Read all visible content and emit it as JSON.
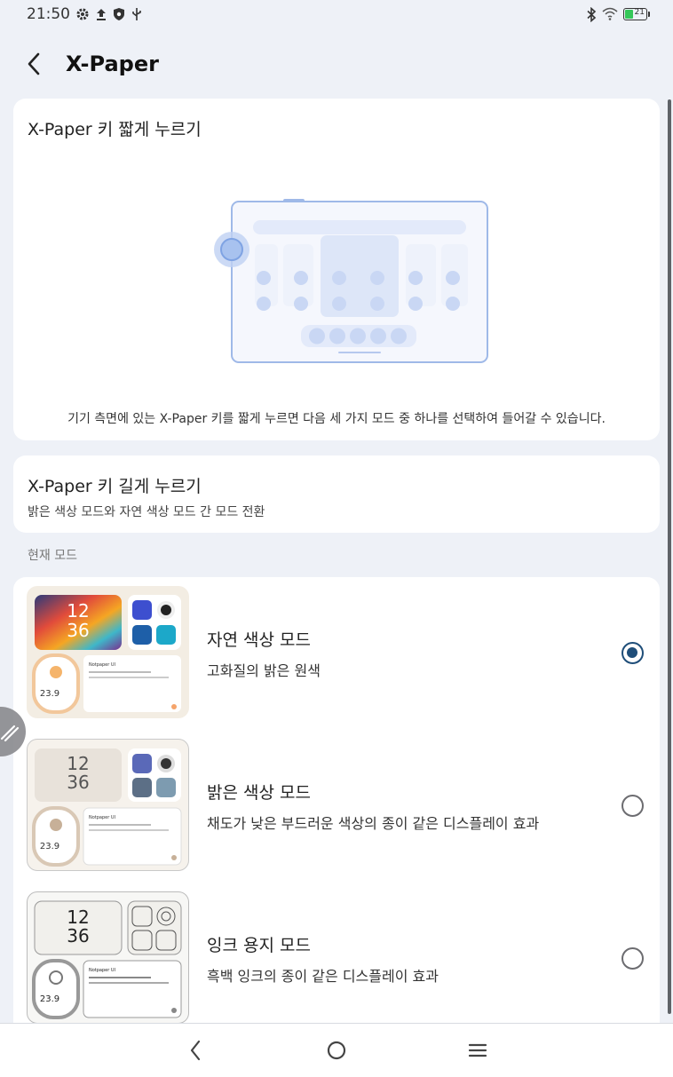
{
  "status_bar": {
    "time": "21:50",
    "icons_left": [
      "settings-icon",
      "upload-icon",
      "shield-icon",
      "usb-icon"
    ],
    "icons_right": [
      "bluetooth-icon",
      "wifi-icon",
      "battery-icon"
    ],
    "battery_level": "21"
  },
  "header": {
    "title": "X-Paper",
    "back_icon": "back-arrow-icon"
  },
  "short_press": {
    "title": "X-Paper 키 짧게 누르기",
    "description": "기기 측면에 있는 X-Paper 키를 짧게 누르면 다음 세 가지 모드 중 하나를 선택하여 들어갈 수 있습니다."
  },
  "long_press": {
    "title": "X-Paper 키 길게 누르기",
    "description": "밝은 색상 모드와 자연 색상 모드 간 모드 전환"
  },
  "current_mode_label": "현재 모드",
  "modes": [
    {
      "title": "자연 색상 모드",
      "description": "고화질의 밝은 원색",
      "selected": true,
      "thumb": {
        "clock_h": "12",
        "clock_m": "36",
        "ring_value": "23.9",
        "card_title": "Notpaper UI"
      }
    },
    {
      "title": "밝은 색상 모드",
      "description": "채도가 낮은 부드러운 색상의 종이 같은 디스플레이 효과",
      "selected": false,
      "thumb": {
        "clock_h": "12",
        "clock_m": "36",
        "ring_value": "23.9",
        "card_title": "Notpaper UI"
      }
    },
    {
      "title": "잉크 용지 모드",
      "description": "흑백 잉크의 종이 같은 디스플레이 효과",
      "selected": false,
      "thumb": {
        "clock_h": "12",
        "clock_m": "36",
        "ring_value": "23.9",
        "card_title": "Notpaper UI"
      }
    }
  ],
  "nav_bar": {
    "back": "back-icon",
    "home": "home-icon",
    "menu": "menu-icon"
  },
  "colors": {
    "accent": "#1f4e79",
    "background": "#eef1f7",
    "card": "#ffffff"
  }
}
